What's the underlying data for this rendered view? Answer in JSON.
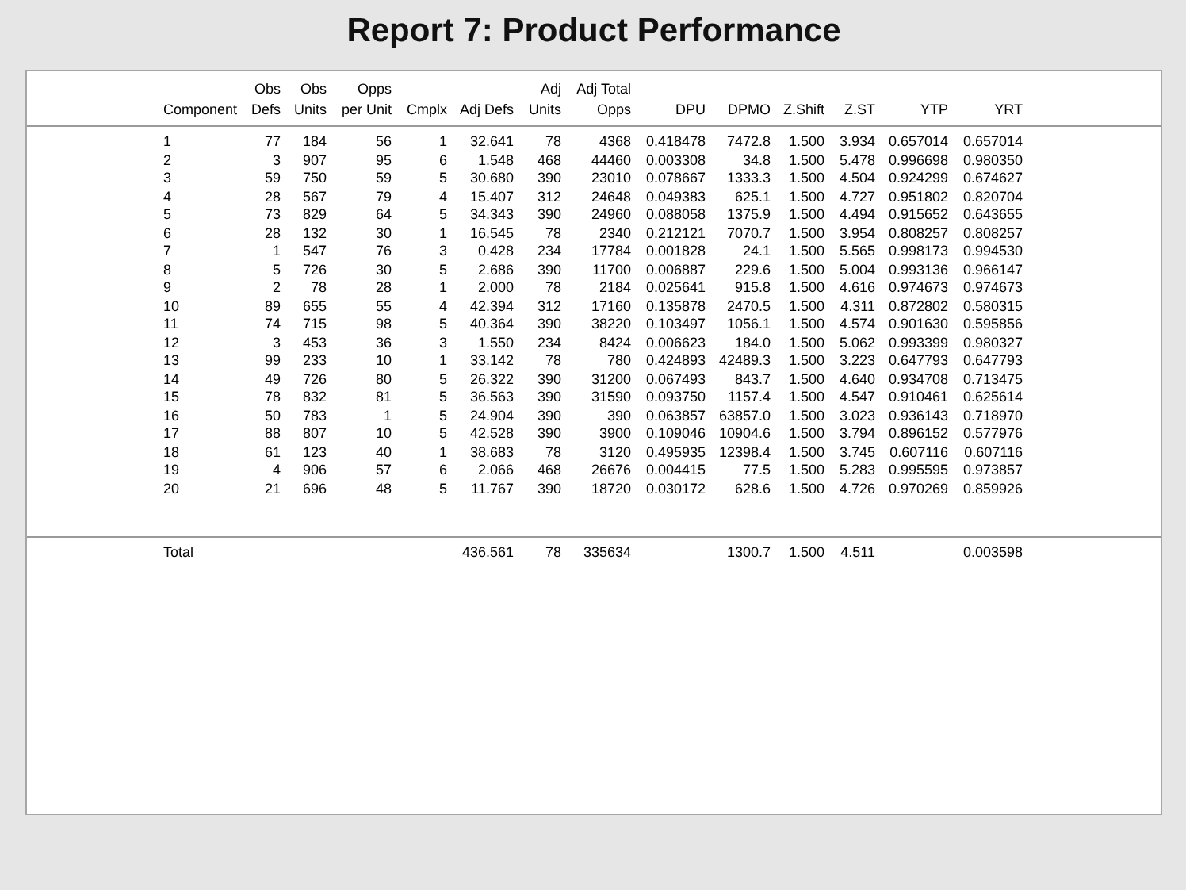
{
  "title": "Report 7: Product Performance",
  "table": {
    "columns": [
      {
        "bottom": "Component"
      },
      {
        "top": "Obs",
        "bottom": "Defs"
      },
      {
        "top": "Obs",
        "bottom": "Units"
      },
      {
        "top": "Opps",
        "bottom": "per Unit"
      },
      {
        "bottom": "Cmplx"
      },
      {
        "bottom": "Adj Defs"
      },
      {
        "top": "Adj",
        "bottom": "Units"
      },
      {
        "top": "Adj Total",
        "bottom": "Opps"
      },
      {
        "bottom": "DPU"
      },
      {
        "bottom": "DPMO"
      },
      {
        "bottom": "Z.Shift"
      },
      {
        "bottom": "Z.ST"
      },
      {
        "bottom": "YTP"
      },
      {
        "bottom": "YRT"
      }
    ],
    "rows": [
      [
        "1",
        "77",
        "184",
        "56",
        "1",
        "32.641",
        "78",
        "4368",
        "0.418478",
        "7472.8",
        "1.500",
        "3.934",
        "0.657014",
        "0.657014"
      ],
      [
        "2",
        "3",
        "907",
        "95",
        "6",
        "1.548",
        "468",
        "44460",
        "0.003308",
        "34.8",
        "1.500",
        "5.478",
        "0.996698",
        "0.980350"
      ],
      [
        "3",
        "59",
        "750",
        "59",
        "5",
        "30.680",
        "390",
        "23010",
        "0.078667",
        "1333.3",
        "1.500",
        "4.504",
        "0.924299",
        "0.674627"
      ],
      [
        "4",
        "28",
        "567",
        "79",
        "4",
        "15.407",
        "312",
        "24648",
        "0.049383",
        "625.1",
        "1.500",
        "4.727",
        "0.951802",
        "0.820704"
      ],
      [
        "5",
        "73",
        "829",
        "64",
        "5",
        "34.343",
        "390",
        "24960",
        "0.088058",
        "1375.9",
        "1.500",
        "4.494",
        "0.915652",
        "0.643655"
      ],
      [
        "6",
        "28",
        "132",
        "30",
        "1",
        "16.545",
        "78",
        "2340",
        "0.212121",
        "7070.7",
        "1.500",
        "3.954",
        "0.808257",
        "0.808257"
      ],
      [
        "7",
        "1",
        "547",
        "76",
        "3",
        "0.428",
        "234",
        "17784",
        "0.001828",
        "24.1",
        "1.500",
        "5.565",
        "0.998173",
        "0.994530"
      ],
      [
        "8",
        "5",
        "726",
        "30",
        "5",
        "2.686",
        "390",
        "11700",
        "0.006887",
        "229.6",
        "1.500",
        "5.004",
        "0.993136",
        "0.966147"
      ],
      [
        "9",
        "2",
        "78",
        "28",
        "1",
        "2.000",
        "78",
        "2184",
        "0.025641",
        "915.8",
        "1.500",
        "4.616",
        "0.974673",
        "0.974673"
      ],
      [
        "10",
        "89",
        "655",
        "55",
        "4",
        "42.394",
        "312",
        "17160",
        "0.135878",
        "2470.5",
        "1.500",
        "4.311",
        "0.872802",
        "0.580315"
      ],
      [
        "11",
        "74",
        "715",
        "98",
        "5",
        "40.364",
        "390",
        "38220",
        "0.103497",
        "1056.1",
        "1.500",
        "4.574",
        "0.901630",
        "0.595856"
      ],
      [
        "12",
        "3",
        "453",
        "36",
        "3",
        "1.550",
        "234",
        "8424",
        "0.006623",
        "184.0",
        "1.500",
        "5.062",
        "0.993399",
        "0.980327"
      ],
      [
        "13",
        "99",
        "233",
        "10",
        "1",
        "33.142",
        "78",
        "780",
        "0.424893",
        "42489.3",
        "1.500",
        "3.223",
        "0.647793",
        "0.647793"
      ],
      [
        "14",
        "49",
        "726",
        "80",
        "5",
        "26.322",
        "390",
        "31200",
        "0.067493",
        "843.7",
        "1.500",
        "4.640",
        "0.934708",
        "0.713475"
      ],
      [
        "15",
        "78",
        "832",
        "81",
        "5",
        "36.563",
        "390",
        "31590",
        "0.093750",
        "1157.4",
        "1.500",
        "4.547",
        "0.910461",
        "0.625614"
      ],
      [
        "16",
        "50",
        "783",
        "1",
        "5",
        "24.904",
        "390",
        "390",
        "0.063857",
        "63857.0",
        "1.500",
        "3.023",
        "0.936143",
        "0.718970"
      ],
      [
        "17",
        "88",
        "807",
        "10",
        "5",
        "42.528",
        "390",
        "3900",
        "0.109046",
        "10904.6",
        "1.500",
        "3.794",
        "0.896152",
        "0.577976"
      ],
      [
        "18",
        "61",
        "123",
        "40",
        "1",
        "38.683",
        "78",
        "3120",
        "0.495935",
        "12398.4",
        "1.500",
        "3.745",
        "0.607116",
        "0.607116"
      ],
      [
        "19",
        "4",
        "906",
        "57",
        "6",
        "2.066",
        "468",
        "26676",
        "0.004415",
        "77.5",
        "1.500",
        "5.283",
        "0.995595",
        "0.973857"
      ],
      [
        "20",
        "21",
        "696",
        "48",
        "5",
        "11.767",
        "390",
        "18720",
        "0.030172",
        "628.6",
        "1.500",
        "4.726",
        "0.970269",
        "0.859926"
      ]
    ],
    "total": {
      "label": "Total",
      "adj_defs": "436.561",
      "adj_units": "78",
      "adj_total_opps": "335634",
      "dpmo": "1300.7",
      "z_shift": "1.500",
      "z_st": "4.511",
      "yrt": "0.003598"
    }
  }
}
